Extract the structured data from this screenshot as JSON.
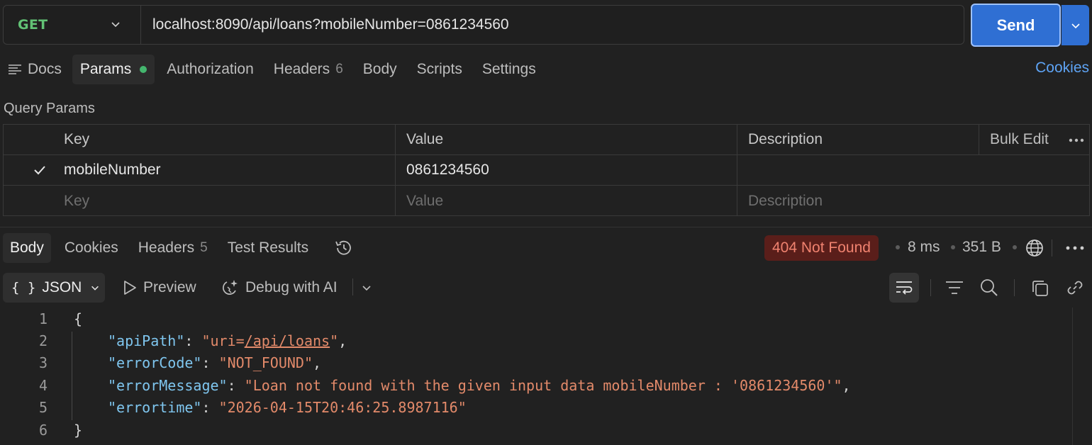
{
  "request": {
    "method": "GET",
    "url": "localhost:8090/api/loans?mobileNumber=0861234560",
    "send_label": "Send"
  },
  "request_tabs": [
    {
      "label": "Docs"
    },
    {
      "label": "Params"
    },
    {
      "label": "Authorization"
    },
    {
      "label": "Headers",
      "count": "6"
    },
    {
      "label": "Body"
    },
    {
      "label": "Scripts"
    },
    {
      "label": "Settings"
    }
  ],
  "cookies_link": "Cookies",
  "query_params": {
    "title": "Query Params",
    "headers": {
      "key": "Key",
      "value": "Value",
      "description": "Description",
      "bulk_edit": "Bulk Edit"
    },
    "rows": [
      {
        "key": "mobileNumber",
        "value": "0861234560",
        "description": "",
        "checked": true
      }
    ],
    "placeholders": {
      "key": "Key",
      "value": "Value",
      "description": "Description"
    }
  },
  "response_tabs": [
    {
      "label": "Body"
    },
    {
      "label": "Cookies"
    },
    {
      "label": "Headers",
      "count": "5"
    },
    {
      "label": "Test Results"
    }
  ],
  "response_meta": {
    "status": "404 Not Found",
    "status_color": "#f0826f",
    "time": "8 ms",
    "size": "351 B"
  },
  "format_toolbar": {
    "format": "JSON",
    "preview": "Preview",
    "debug": "Debug with AI"
  },
  "body_lines": [
    {
      "num": "1"
    },
    {
      "num": "2",
      "key": "\"apiPath\"",
      "val_pre": "\"uri=",
      "val_link": "/api/loans",
      "val_post": "\"",
      "tail": ","
    },
    {
      "num": "3",
      "key": "\"errorCode\"",
      "val": "\"NOT_FOUND\"",
      "tail": ","
    },
    {
      "num": "4",
      "key": "\"errorMessage\"",
      "val": "\"Loan not found with the given input data mobileNumber : '0861234560'\"",
      "tail": ","
    },
    {
      "num": "5",
      "key": "\"errortime\"",
      "val": "\"2026-04-15T20:46:25.8987116\"",
      "tail": ""
    },
    {
      "num": "6"
    }
  ],
  "icons": [
    "chevron-down-icon",
    "docs-icon",
    "check-icon",
    "more-icon",
    "history-icon",
    "globe-icon",
    "play-icon",
    "ai-debug-icon",
    "wrap-icon",
    "filter-icon",
    "search-icon",
    "copy-icon",
    "link-icon"
  ]
}
